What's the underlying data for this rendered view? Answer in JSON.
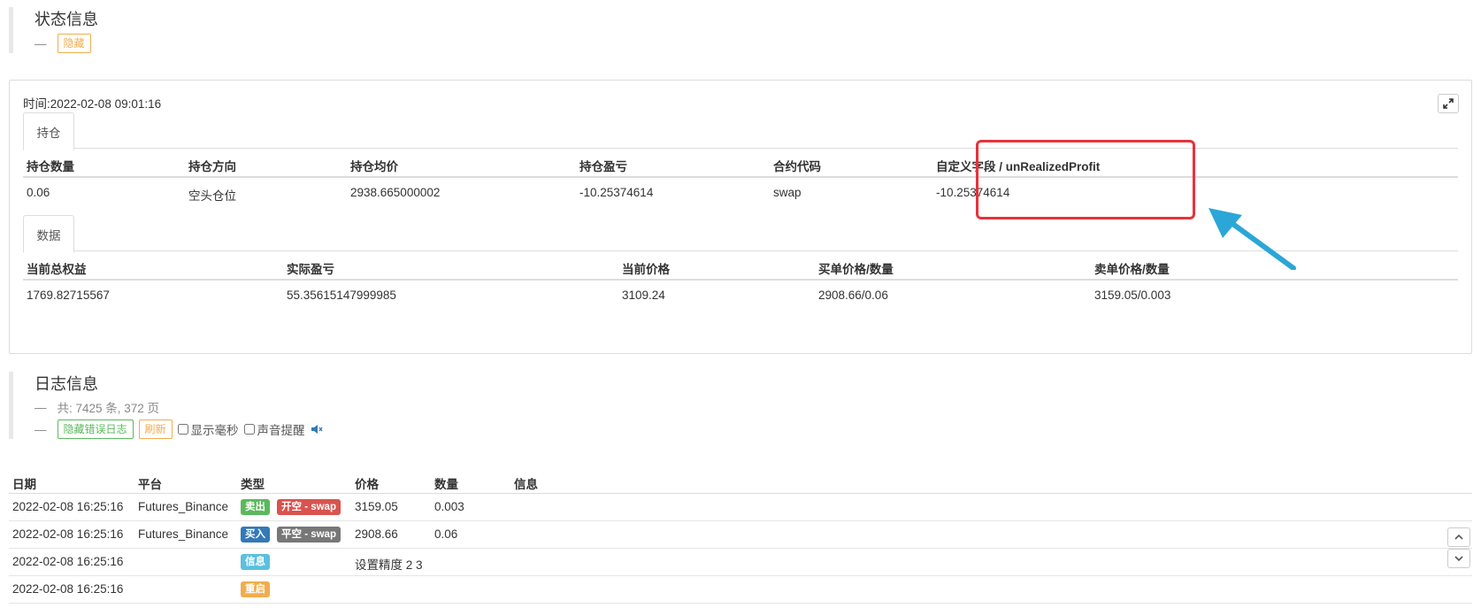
{
  "status": {
    "title": "状态信息",
    "hide_label": "隐藏",
    "dash": "—"
  },
  "panel": {
    "time_label": "时间:",
    "time_value": "2022-02-08 09:01:16",
    "positions_tab": "持仓",
    "positions_columns": [
      "持仓数量",
      "持仓方向",
      "持仓均价",
      "持仓盈亏",
      "合约代码",
      "自定义字段 / unRealizedProfit"
    ],
    "positions_rows": [
      [
        "0.06",
        "空头仓位",
        "2938.665000002",
        "-10.25374614",
        "swap",
        "-10.25374614"
      ]
    ],
    "data_tab": "数据",
    "data_columns": [
      "当前总权益",
      "实际盈亏",
      "当前价格",
      "买单价格/数量",
      "卖单价格/数量"
    ],
    "data_rows": [
      [
        "1769.82715567",
        "55.35615147999985",
        "3109.24",
        "2908.66/0.06",
        "3159.05/0.003"
      ]
    ]
  },
  "log": {
    "title": "日志信息",
    "summary": "共: 7425 条, 372 页",
    "hide_error_label": "隐藏错误日志",
    "refresh_label": "刷新",
    "show_ms_label": "显示毫秒",
    "sound_label": "声音提醒",
    "columns": [
      "日期",
      "平台",
      "类型",
      "价格",
      "数量",
      "信息"
    ],
    "rows": [
      {
        "date": "2022-02-08 16:25:16",
        "platform": "Futures_Binance",
        "type": "卖出",
        "type_color": "green",
        "action": "开空 - swap",
        "action_color": "red",
        "price": "3159.05",
        "amount": "0.003",
        "info": ""
      },
      {
        "date": "2022-02-08 16:25:16",
        "platform": "Futures_Binance",
        "type": "买入",
        "type_color": "blue",
        "action": "平空 - swap",
        "action_color": "gray",
        "price": "2908.66",
        "amount": "0.06",
        "info": ""
      },
      {
        "date": "2022-02-08 16:25:16",
        "platform": "",
        "type": "信息",
        "type_color": "cyan",
        "action": "",
        "action_color": "",
        "price": "设置精度 2 3",
        "amount": "",
        "info": ""
      },
      {
        "date": "2022-02-08 16:25:16",
        "platform": "",
        "type": "重启",
        "type_color": "orange",
        "action": "",
        "action_color": "",
        "price": "",
        "amount": "",
        "info": ""
      }
    ]
  },
  "colors": {
    "highlight": "#e8323a",
    "arrow": "#2aa7d6"
  }
}
